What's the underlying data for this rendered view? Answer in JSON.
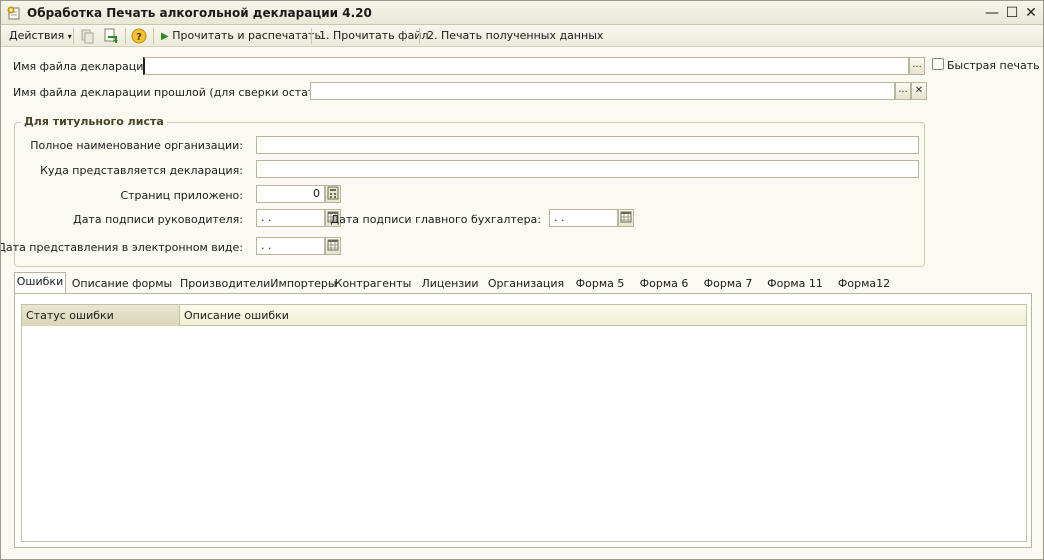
{
  "window": {
    "title": "Обработка  Печать алкогольной декларации 4.20",
    "minimize_glyph": "—",
    "maximize_glyph": "☐",
    "close_glyph": "✕"
  },
  "toolbar": {
    "actions_label": "Действия",
    "help_glyph": "?",
    "read_print_label": "Прочитать и распечатать",
    "read_file_label": "1. Прочитать файл",
    "print_data_label": "2. Печать полученных данных"
  },
  "form": {
    "decl_file_label": "Имя файла декларации:",
    "decl_file_value": "",
    "prev_decl_file_label": "Имя файла декларации прошлой (для сверки остатков):",
    "prev_decl_file_value": "",
    "quick_print_label": "Быстрая печать",
    "quick_print_checked": false,
    "browse_glyph": "...",
    "clear_glyph": "✕"
  },
  "title_group": {
    "title": "Для титульного листа",
    "org_name_label": "Полное наименование организации:",
    "org_name_value": "",
    "recipient_label": "Куда представляется декларация:",
    "recipient_value": "",
    "pages_label": "Страниц приложено:",
    "pages_value": "0",
    "head_sign_date_label": "Дата подписи руководителя:",
    "head_sign_date_value": " .  .",
    "accountant_sign_date_label": "Дата подписи главного бухгалтера:",
    "accountant_sign_date_value": " .  .",
    "electronic_date_label": "Дата представления в электронном виде:",
    "electronic_date_value": " .  ."
  },
  "tabs": [
    {
      "label": "Ошибки",
      "active": true
    },
    {
      "label": "Описание формы"
    },
    {
      "label": "ПроизводителиИмпортеры"
    },
    {
      "label": "Контрагенты"
    },
    {
      "label": "Лицензии"
    },
    {
      "label": "Организация"
    },
    {
      "label": "Форма 5"
    },
    {
      "label": "Форма 6"
    },
    {
      "label": "Форма 7"
    },
    {
      "label": "Форма 11"
    },
    {
      "label": "Форма12"
    }
  ],
  "errors_table": {
    "columns": [
      "Статус ошибки",
      "Описание ошибки"
    ],
    "rows": []
  },
  "colors": {
    "background": "#fbfaf2",
    "accent_green": "#2f8a1f",
    "group_title": "#4a4426"
  }
}
